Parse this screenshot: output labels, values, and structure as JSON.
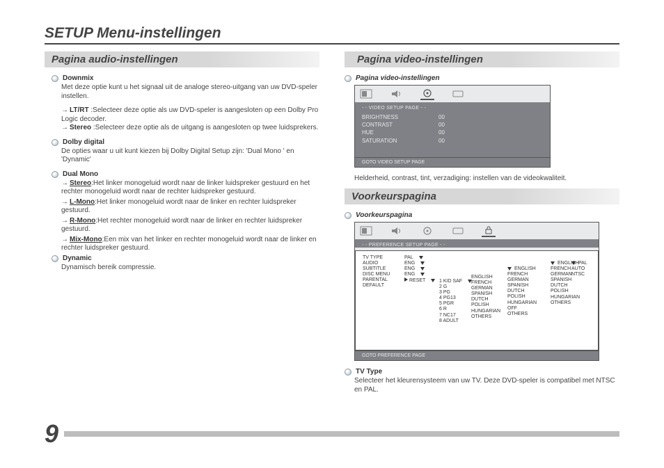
{
  "page": {
    "title": "SETUP Menu-instellingen",
    "number": "9"
  },
  "audio": {
    "section": "Pagina audio-instellingen",
    "downmix": {
      "heading": "Downmix",
      "intro": "Met deze optie kunt u het signaal uit de analoge stereo-uitgang van uw DVD-speler instellen.",
      "ltrt_label": "LT/RT",
      "ltrt_text": " :Selecteer deze optie als uw DVD-speler is aangesloten op een Dolby Pro Logic decoder.",
      "stereo_label": "Stereo",
      "stereo_text": " :Selecteer deze optie als de uitgang is aangesloten op twee luidsprekers."
    },
    "dolby": {
      "heading": "Dolby digital",
      "text": "De opties waar u uit kunt kiezen bij Dolby Digital Setup zijn: 'Dual Mono ' en 'Dynamic'"
    },
    "dualmono": {
      "heading": "Dual Mono",
      "stereo_label": "Stereo",
      "stereo_text": ":Het linker monogeluid wordt naar de linker luidspreker gestuurd en het rechter monogeluid wordt naar de rechter luidspreker gestuurd.",
      "lmono_label": "L-Mono",
      "lmono_text": ":Het linker monogeluid wordt naar de linker en rechter luidspreker gestuurd.",
      "rmono_label": "R-Mono",
      "rmono_text": ":Het rechter monogeluid wordt naar de linker en rechter luidspreker gestuurd.",
      "mixmono_label": "Mix-Mono",
      "mixmono_text": ":Een mix van het linker en rechter monogeluid wordt naar de linker en rechter luidspreker gestuurd."
    },
    "dynamic": {
      "heading": "Dynamic",
      "text": "Dynamisch bereik compressie."
    }
  },
  "video": {
    "section": "Pagina video-instellingen",
    "sub": "Pagina video-instellingen",
    "osd_title": "- -  VIDEO SETUP PAGE   - -",
    "rows": [
      {
        "k": "BRIGHTNESS",
        "v": "00"
      },
      {
        "k": "CONTRAST",
        "v": "00"
      },
      {
        "k": "HUE",
        "v": "00"
      },
      {
        "k": "SATURATION",
        "v": "00"
      }
    ],
    "osd_footer": "GOTO VIDEO SETUP PAGE",
    "caption": "Helderheid, contrast, tint, verzadiging: instellen van de videokwaliteit."
  },
  "pref": {
    "section": "Voorkeurspagina",
    "sub": "Voorkeurspagina",
    "osd_title": "- -  PREFERENCE SETUP PAGE   - -",
    "left": [
      "TV TYPE",
      "AUDIO",
      "SUBTITLE",
      "DISC MENU",
      "PARENTAL",
      "DEFAULT"
    ],
    "mid": [
      "PAL",
      "ENG",
      "ENG",
      "ENG",
      "",
      "RESET"
    ],
    "ratings": [
      "1 KID SAF",
      "2 G",
      "3 PG",
      "4 PG13",
      "5 PGR",
      "6 R",
      "7 NC17",
      "8 ADULT"
    ],
    "langs": [
      "ENGLISH",
      "FRENCH",
      "GERMAN",
      "SPANISH",
      "DUTCH",
      "POLISH",
      "HUNGARIAN",
      "OTHERS"
    ],
    "langs2": [
      "ENGLISH",
      "FRENCH",
      "GERMAN",
      "SPANISH",
      "DUTCH",
      "POLISH",
      "HUNGARIAN",
      "OFF",
      "OTHERS"
    ],
    "langs3": [
      "ENGLISH",
      "FRENCH",
      "GERMAN",
      "SPANISH",
      "DUTCH",
      "POLISH",
      "HUNGARIAN",
      "OTHERS"
    ],
    "tvtype": [
      "PAL",
      "AUTO",
      "NTSC"
    ],
    "osd_footer": "GOTO PREFERENCE PAGE",
    "tv_heading": "TV Type",
    "tv_text": "Selecteer het kleurensysteem van uw TV. Deze DVD-speler is compatibel met NTSC en PAL."
  }
}
